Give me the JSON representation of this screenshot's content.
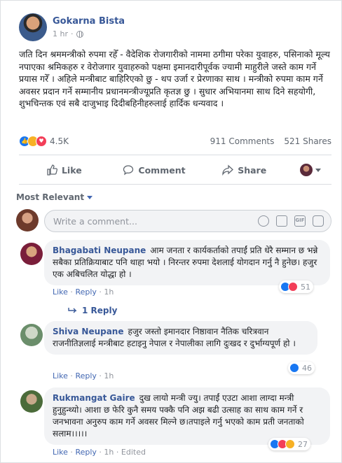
{
  "post": {
    "author": "Gokarna Bista",
    "time": "1 hr",
    "separator": "·",
    "text": "जति दिन श्रममन्त्रीको रुपमा रहेँ - वैदेशिक रोजगारीको नाममा ठगीमा परेका युवाहरु, पसिनाको मूल्य नपाएका श्रमिकहरु र वेरोजगार युवाहरुको पक्षमा इमानदारीपूर्वक ज्यामी माहुरीले जस्ते काम गर्ने प्रयास गरेँ । अहिले मन्त्रीबाट बाहिरिएको छु - थप उर्जा र प्रेरणाका साथ । मन्त्रीको रुपमा काम गर्ने अवसर प्रदान गर्ने सम्मानीय प्रधानमन्त्रीज्यूप्रति कृतज्ञ छु । सुधार अभियानमा साथ दिने सहयोगी, शुभचिन्तक एवं सबै दाजुभाइ दिदीबहिनीहरुलाई हार्दिक धन्यवाद ।",
    "reactions_count": "4.5K",
    "comments_count": "911 Comments",
    "shares_count": "521 Shares"
  },
  "actions": {
    "like": "Like",
    "comment": "Comment",
    "share": "Share"
  },
  "sort_label": "Most Relevant",
  "write_placeholder": "Write a comment...",
  "gif_label": "GIF",
  "comments": [
    {
      "name": "Bhagabati Neupane",
      "text": "आम जनता र कार्यकर्ताको तपाईं प्रति धेरै सम्मान छ भन्ने सबैका प्रतिक्रियाबाट पनि थाहा भयो । निरन्तर रुपमा देशलाई योगदान गर्नु नै हुनेछ। हजुर एक अबिचलित योद्धा हो ।",
      "like": "Like",
      "reply": "Reply",
      "time": "1h",
      "reactions": "51",
      "replies": "1 Reply"
    },
    {
      "name": "Shiva Neupane",
      "text": "हजुर जस्तो इमानदार निष्ठावान नैतिक चरित्रवान राजनीतिज्ञलाई मन्त्रीबाट हटाइनु नेपाल र नेपालीका लागि दुःखद र दुर्भाग्यपूर्ण हो ।",
      "like": "Like",
      "reply": "Reply",
      "time": "1h",
      "reactions": "46"
    },
    {
      "name": "Rukmangat Gaire",
      "text": "दुख लायो मन्त्री ज्यु। तपाईं एउटा आशा लाग्दा मन्त्री हुनुहुन्थ्यो। आशा छ फेरि कुनै समय पक्कै पनि अझ बढी उत्साह का साथ काम गर्ने र जनभावना अनुरुप काम गर्ने अवसर मिल्ने छ।तपाइले गर्नु भएको काम प्रती जनताको सलाम।।।।।",
      "like": "Like",
      "reply": "Reply",
      "time": "1h",
      "edited": "Edited",
      "reactions": "27"
    }
  ],
  "colors": {
    "link_blue": "#385898",
    "like_blue": "#1877f2",
    "love_red": "#f33e58",
    "sad_yellow": "#f7b125",
    "muted": "#90949c"
  }
}
